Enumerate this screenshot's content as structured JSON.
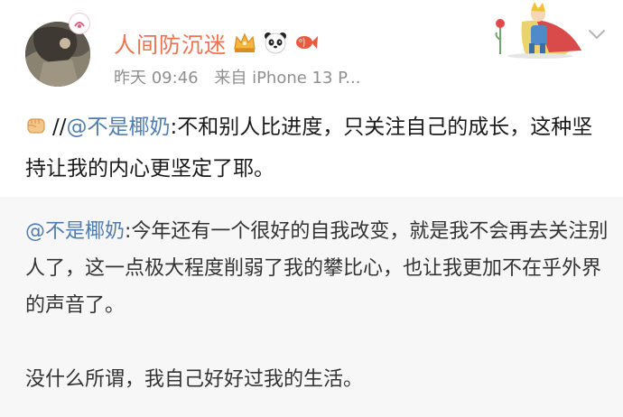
{
  "post": {
    "author": {
      "name": "人间防沉迷",
      "avatar_icon": "avatar-photo",
      "badges": [
        "crown-vip-icon",
        "panda-icon",
        "koi-fish-icon"
      ]
    },
    "meta": {
      "time": "昨天 09:46",
      "source": "来自 iPhone 13 P..."
    },
    "content": {
      "emoji": "fist-icon",
      "prefix": "//",
      "mention": "@不是椰奶",
      "text": ":不和别人比进度，只关注自己的成长，这种坚持让我的内心更坚定了耶。"
    },
    "repost": {
      "mention": "@不是椰奶",
      "text": ":今年还有一个很好的自我改变，就是我不会再去关注别人了，这一点极大程度削弱了我的攀比心，也让我更加不在乎外界的声音了。",
      "text2": "没什么所谓，我自己好好过我的生活。"
    }
  },
  "colors": {
    "username": "#eb7350",
    "mention": "#507daf",
    "meta": "#8f8f8f",
    "repost_bg": "#f7f7f7"
  }
}
